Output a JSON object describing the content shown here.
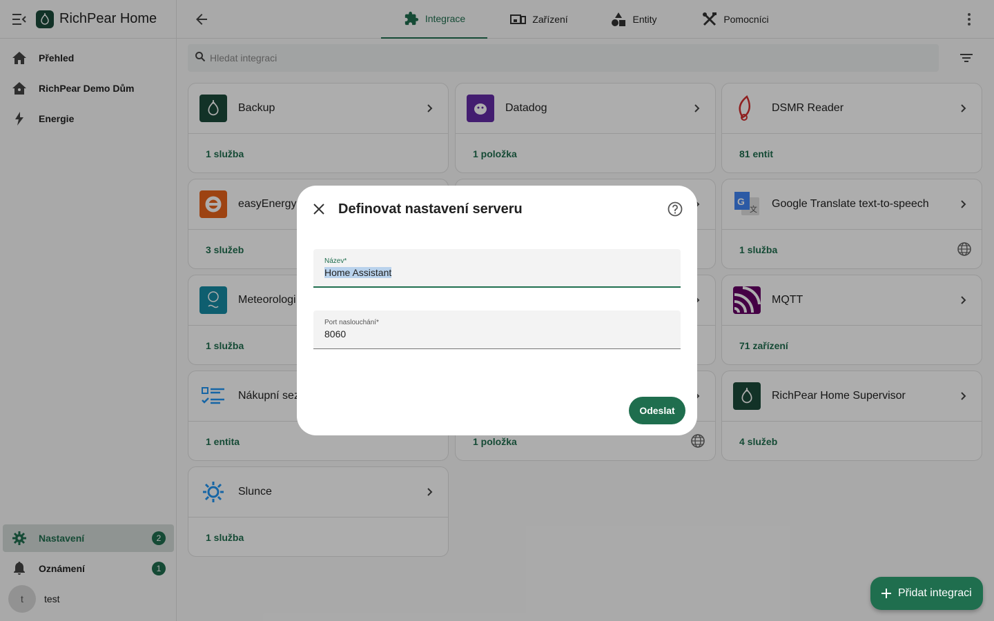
{
  "app": {
    "title": "RichPear Home"
  },
  "sidebar": {
    "items": [
      {
        "label": "Přehled",
        "icon": "home-icon"
      },
      {
        "label": "RichPear Demo Dům",
        "icon": "home-roof-icon"
      },
      {
        "label": "Energie",
        "icon": "lightning-icon"
      }
    ],
    "bottom": [
      {
        "label": "Nastavení",
        "icon": "gear-icon",
        "badge": "2",
        "active": true
      },
      {
        "label": "Oznámení",
        "icon": "bell-icon",
        "badge": "1"
      }
    ],
    "user": {
      "initial": "t",
      "name": "test"
    }
  },
  "tabs": [
    {
      "label": "Integrace",
      "icon": "puzzle-icon",
      "active": true
    },
    {
      "label": "Zařízení",
      "icon": "devices-icon"
    },
    {
      "label": "Entity",
      "icon": "shapes-icon"
    },
    {
      "label": "Pomocníci",
      "icon": "tools-icon"
    }
  ],
  "search": {
    "placeholder": "Hledat integraci"
  },
  "cards": [
    {
      "name": "Backup",
      "link": "1 služba",
      "icon": "richpear-logo-icon"
    },
    {
      "name": "Datadog",
      "link": "1 položka",
      "icon": "datadog-logo-icon"
    },
    {
      "name": "DSMR Reader",
      "link": "81 entit",
      "icon": "dsmr-logo-icon"
    },
    {
      "name": "easyEnergy",
      "link": "3 služeb",
      "icon": "easyenergy-logo-icon"
    },
    {
      "name": "",
      "link": "",
      "icon": ""
    },
    {
      "name": "Google Translate text-to-speech",
      "link": "1 služba",
      "icon": "google-translate-logo-icon",
      "cloud": true
    },
    {
      "name": "Meteorologi",
      "link": "1 služba",
      "icon": "meteorologisk-logo-icon"
    },
    {
      "name": "",
      "link": "",
      "icon": ""
    },
    {
      "name": "MQTT",
      "link": "71 zařízení",
      "icon": "mqtt-logo-icon"
    },
    {
      "name": "Nákupní sez",
      "link": "1 entita",
      "icon": "shopping-list-icon"
    },
    {
      "name": "",
      "link": "1 položka",
      "icon": "",
      "cloud": true
    },
    {
      "name": "RichPear Home Supervisor",
      "link": "4 služeb",
      "icon": "richpear-logo-icon"
    },
    {
      "name": "Slunce",
      "link": "1 služba",
      "icon": "sun-icon"
    }
  ],
  "dialog": {
    "title": "Definovat nastavení serveru",
    "fields": [
      {
        "label": "Název*",
        "value": "Home Assistant"
      },
      {
        "label": "Port naslouchání*",
        "value": "8060"
      }
    ],
    "submit": "Odeslat"
  },
  "fab": {
    "label": "Přidat integraci"
  },
  "colors": {
    "accent": "#1f6e4e",
    "scrim": "rgba(0,0,0,0.32)"
  }
}
